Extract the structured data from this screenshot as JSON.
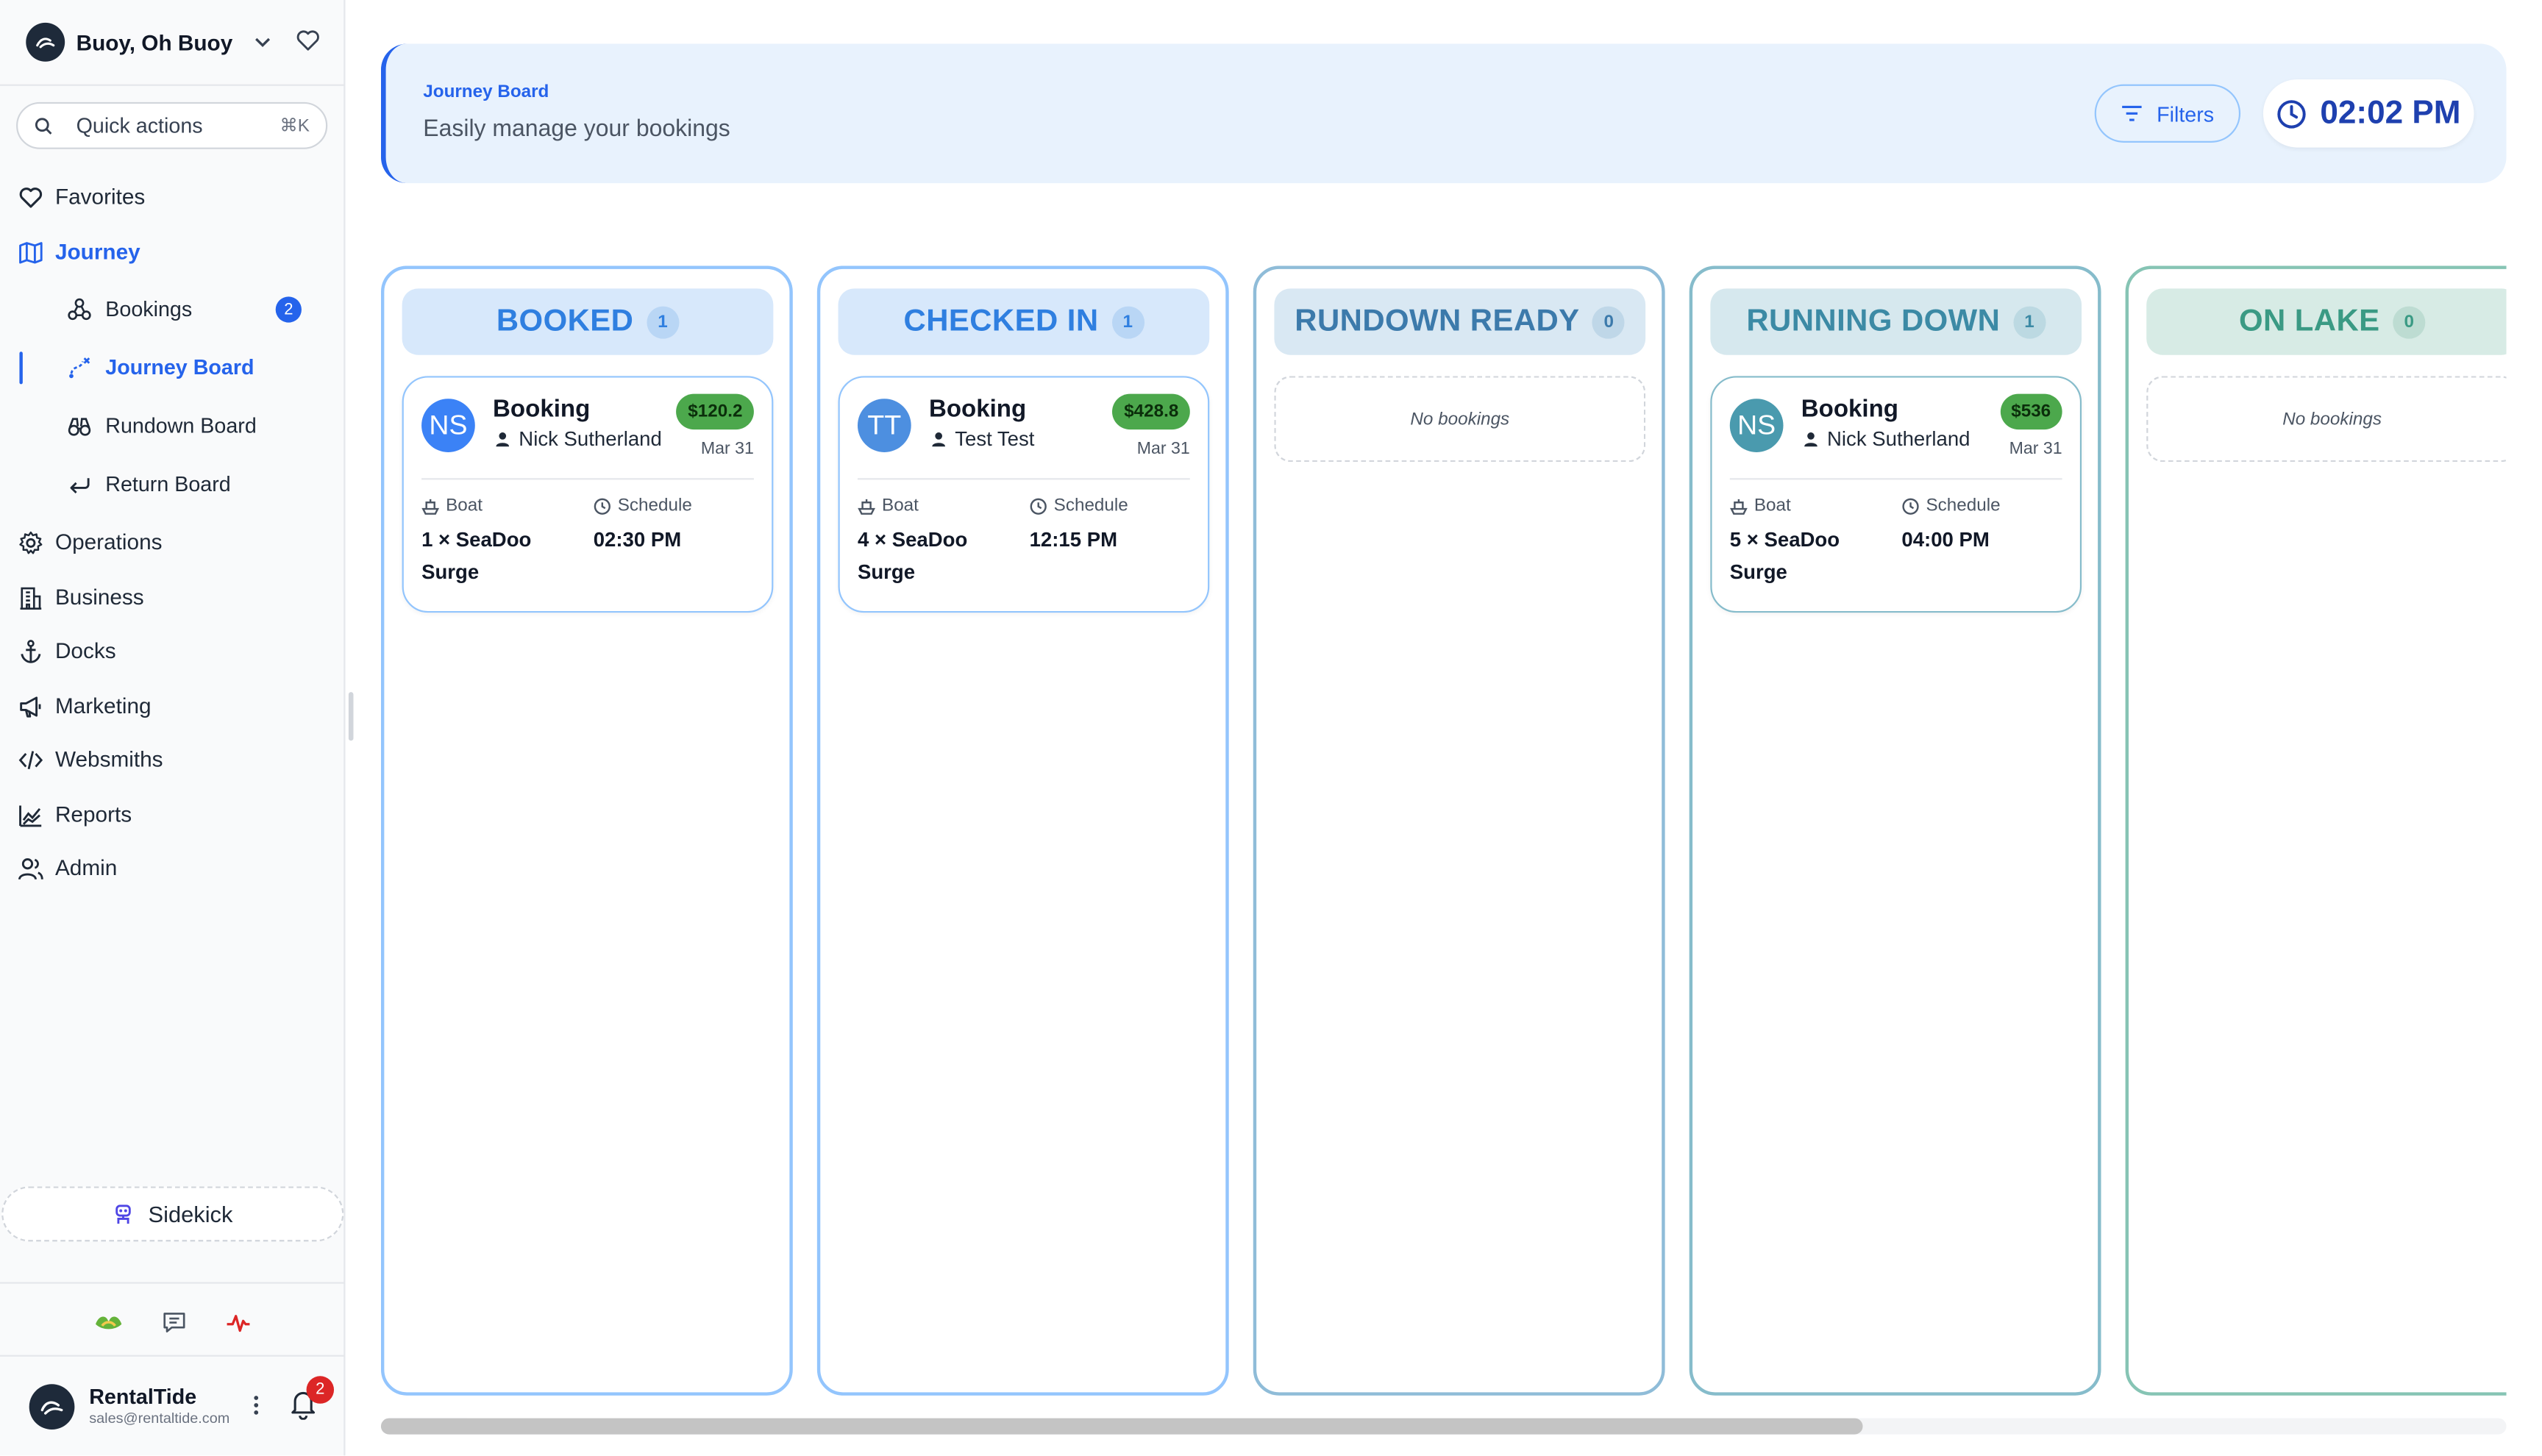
{
  "sidebar": {
    "org_name": "Buoy, Oh Buoy",
    "quick_actions": {
      "label": "Quick actions",
      "shortcut": "⌘K"
    },
    "nav": {
      "favorites": "Favorites",
      "journey": "Journey",
      "operations": "Operations",
      "business": "Business",
      "docks": "Docks",
      "marketing": "Marketing",
      "websmiths": "Websmiths",
      "reports": "Reports",
      "admin": "Admin"
    },
    "journey_sub": {
      "bookings": "Bookings",
      "bookings_badge": "2",
      "journey_board": "Journey Board",
      "rundown_board": "Rundown Board",
      "return_board": "Return Board"
    },
    "sidekick": "Sidekick",
    "user": {
      "name": "RentalTide",
      "email": "sales@rentaltide.com",
      "notifications": "2"
    }
  },
  "header": {
    "breadcrumb": "Journey Board",
    "subtitle": "Easily manage your bookings",
    "filters_label": "Filters",
    "time": "02:02 PM"
  },
  "columns": {
    "booked": {
      "title": "BOOKED",
      "count": "1",
      "color": "#2f7fe0"
    },
    "checked_in": {
      "title": "CHECKED IN",
      "count": "1",
      "color": "#2f7fe0"
    },
    "rundown_ready": {
      "title": "RUNDOWN READY",
      "count": "0",
      "empty": "No bookings",
      "color": "#3c7aab"
    },
    "running_down": {
      "title": "RUNNING DOWN",
      "count": "1",
      "color": "#3c8aa5"
    },
    "on_lake": {
      "title": "ON LAKE",
      "count": "0",
      "empty": "No bookings",
      "color": "#3a9a84"
    }
  },
  "cards": {
    "booked_0": {
      "initials": "NS",
      "title": "Booking",
      "person": "Nick Sutherland",
      "price": "$120.2",
      "date": "Mar 31",
      "boat_label": "Boat",
      "schedule_label": "Schedule",
      "boat": "1 × SeaDoo Surge",
      "time": "02:30 PM"
    },
    "checked_in_0": {
      "initials": "TT",
      "title": "Booking",
      "person": "Test Test",
      "price": "$428.8",
      "date": "Mar 31",
      "boat_label": "Boat",
      "schedule_label": "Schedule",
      "boat": "4 × SeaDoo Surge",
      "time": "12:15 PM"
    },
    "running_down_0": {
      "initials": "NS",
      "title": "Booking",
      "person": "Nick Sutherland",
      "price": "$536",
      "date": "Mar 31",
      "boat_label": "Boat",
      "schedule_label": "Schedule",
      "boat": "5 × SeaDoo Surge",
      "time": "04:00 PM"
    }
  },
  "icons": {
    "org_logo": "wave-logo-icon",
    "favorite": "heart-icon",
    "search": "search-icon",
    "journey": "map-icon",
    "bookings": "share-nodes-icon",
    "journey_board": "route-icon",
    "rundown_board": "binoculars-icon",
    "return_board": "return-arrow-icon",
    "operations": "gear-icon",
    "business": "building-icon",
    "docks": "anchor-icon",
    "marketing": "megaphone-icon",
    "websmiths": "code-icon",
    "reports": "chart-icon",
    "admin": "users-icon",
    "sidekick": "robot-icon",
    "filters": "filter-lines-icon",
    "clock": "clock-icon"
  },
  "colors": {
    "accent": "#2563eb",
    "price_badge": "#4ca84c",
    "notification": "#dc2626"
  }
}
